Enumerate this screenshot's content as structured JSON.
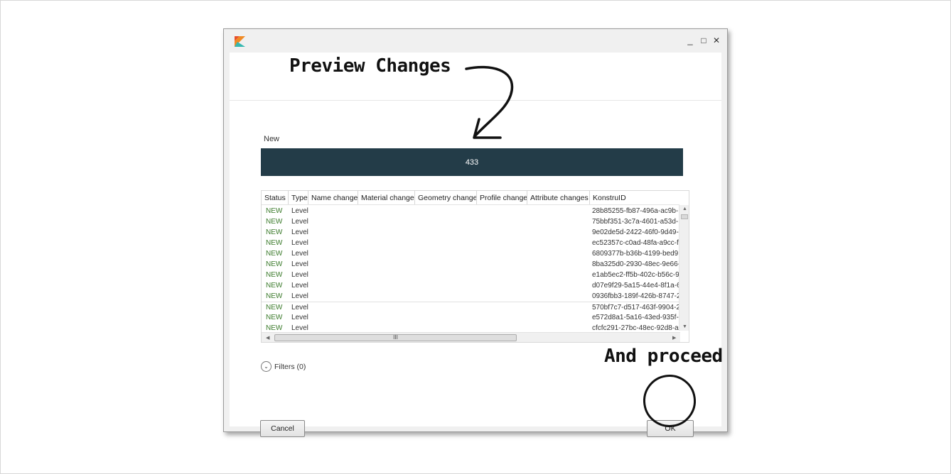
{
  "window": {
    "controls": {
      "minimize": "_",
      "maximize": "□",
      "close": "✕"
    }
  },
  "annotations": {
    "preview": "Preview Changes",
    "proceed": "And proceed"
  },
  "summary": {
    "label": "New",
    "count": "433",
    "bar_color": "#233c48"
  },
  "grid": {
    "columns": [
      "Status",
      "Type",
      "Name change",
      "Material change",
      "Geometry change",
      "Profile change",
      "Attribute changes",
      "KonstruID"
    ],
    "rows": [
      {
        "status": "NEW",
        "type": "Level",
        "id": "28b85255-fb87-496a-ac9b-"
      },
      {
        "status": "NEW",
        "type": "Level",
        "id": "75bbf351-3c7a-4601-a53d-"
      },
      {
        "status": "NEW",
        "type": "Level",
        "id": "9e02de5d-2422-46f0-9d49-"
      },
      {
        "status": "NEW",
        "type": "Level",
        "id": "ec52357c-c0ad-48fa-a9cc-f"
      },
      {
        "status": "NEW",
        "type": "Level",
        "id": "6809377b-b36b-4199-bed9"
      },
      {
        "status": "NEW",
        "type": "Level",
        "id": "8ba325d0-2930-48ec-9e66-"
      },
      {
        "status": "NEW",
        "type": "Level",
        "id": "e1ab5ec2-ff5b-402c-b56c-9"
      },
      {
        "status": "NEW",
        "type": "Level",
        "id": "d07e9f29-5a15-44e4-8f1a-6"
      },
      {
        "status": "NEW",
        "type": "Level",
        "id": "0936fbb3-189f-426b-8747-2"
      },
      {
        "status": "NEW",
        "type": "Level",
        "id": "570bf7c7-d517-463f-9904-2"
      },
      {
        "status": "NEW",
        "type": "Level",
        "id": "e572d8a1-5a16-43ed-935f-l"
      },
      {
        "status": "NEW",
        "type": "Level",
        "id": "cfcfc291-27bc-48ec-92d8-a"
      }
    ],
    "hscroll_grip": "III"
  },
  "filters": {
    "label": "Filters (0)"
  },
  "buttons": {
    "cancel": "Cancel",
    "ok": "OK"
  }
}
